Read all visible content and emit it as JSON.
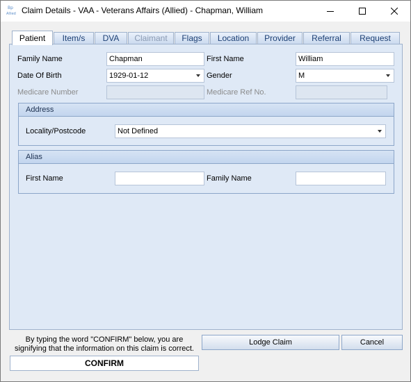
{
  "window": {
    "title": "Claim Details - VAA - Veterans Affairs (Allied) - Chapman, William",
    "icon": "app-logo-icon",
    "icon_text_top": "Bp",
    "icon_text_bottom": "Allied"
  },
  "tabs": [
    {
      "label": "Patient",
      "state": "active"
    },
    {
      "label": "Item/s",
      "state": "normal"
    },
    {
      "label": "DVA",
      "state": "normal"
    },
    {
      "label": "Claimant",
      "state": "disabled"
    },
    {
      "label": "Flags",
      "state": "normal"
    },
    {
      "label": "Location",
      "state": "normal"
    },
    {
      "label": "Provider",
      "state": "normal"
    },
    {
      "label": "Referral",
      "state": "normal"
    },
    {
      "label": "Request",
      "state": "normal"
    }
  ],
  "patient": {
    "family_name_label": "Family Name",
    "family_name_value": "Chapman",
    "first_name_label": "First Name",
    "first_name_value": "William",
    "dob_label": "Date Of Birth",
    "dob_value": "1929-01-12",
    "gender_label": "Gender",
    "gender_value": "M",
    "medicare_number_label": "Medicare Number",
    "medicare_number_value": "",
    "medicare_ref_label": "Medicare Ref No.",
    "medicare_ref_value": ""
  },
  "address": {
    "heading": "Address",
    "locality_label": "Locality/Postcode",
    "locality_value": "Not Defined"
  },
  "alias": {
    "heading": "Alias",
    "first_name_label": "First Name",
    "first_name_value": "",
    "family_name_label": "Family Name",
    "family_name_value": ""
  },
  "footer": {
    "note": "By typing the word \"CONFIRM\" below, you are signifying that the information on this claim is correct.",
    "confirm_value": "CONFIRM",
    "lodge_label": "Lodge Claim",
    "cancel_label": "Cancel"
  },
  "colors": {
    "panel_bg": "#dfe9f6",
    "tab_text": "#1c3f74",
    "border": "#8ca6c9"
  }
}
